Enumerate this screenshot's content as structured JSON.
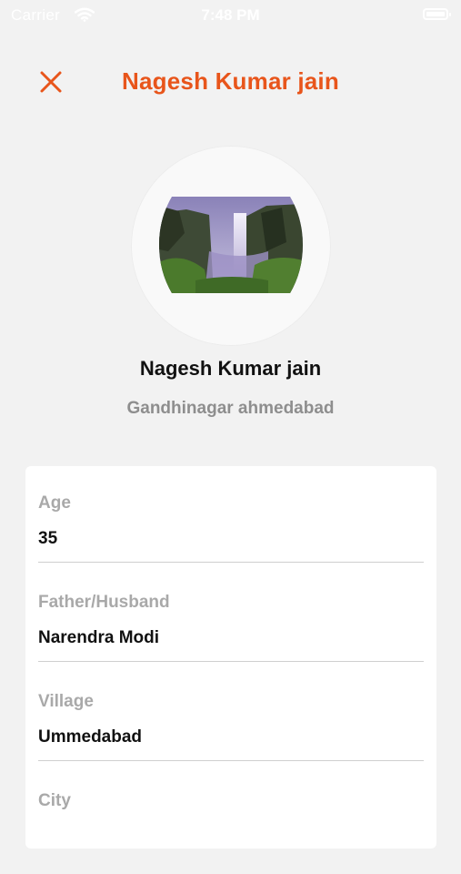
{
  "status_bar": {
    "carrier": "Carrier",
    "time": "7:48 PM",
    "wifi_icon": "wifi-icon",
    "battery_icon": "battery-icon"
  },
  "nav": {
    "title": "Nagesh Kumar jain",
    "close_icon": "close-icon",
    "accent_color": "#e8551b"
  },
  "profile": {
    "name": "Nagesh Kumar jain",
    "location": "Gandhinagar ahmedabad",
    "avatar": "waterfall-photo"
  },
  "fields": [
    {
      "label": "Age",
      "value": "35"
    },
    {
      "label": "Father/Husband",
      "value": "Narendra Modi"
    },
    {
      "label": "Village",
      "value": "Ummedabad"
    },
    {
      "label": "City",
      "value": ""
    }
  ]
}
